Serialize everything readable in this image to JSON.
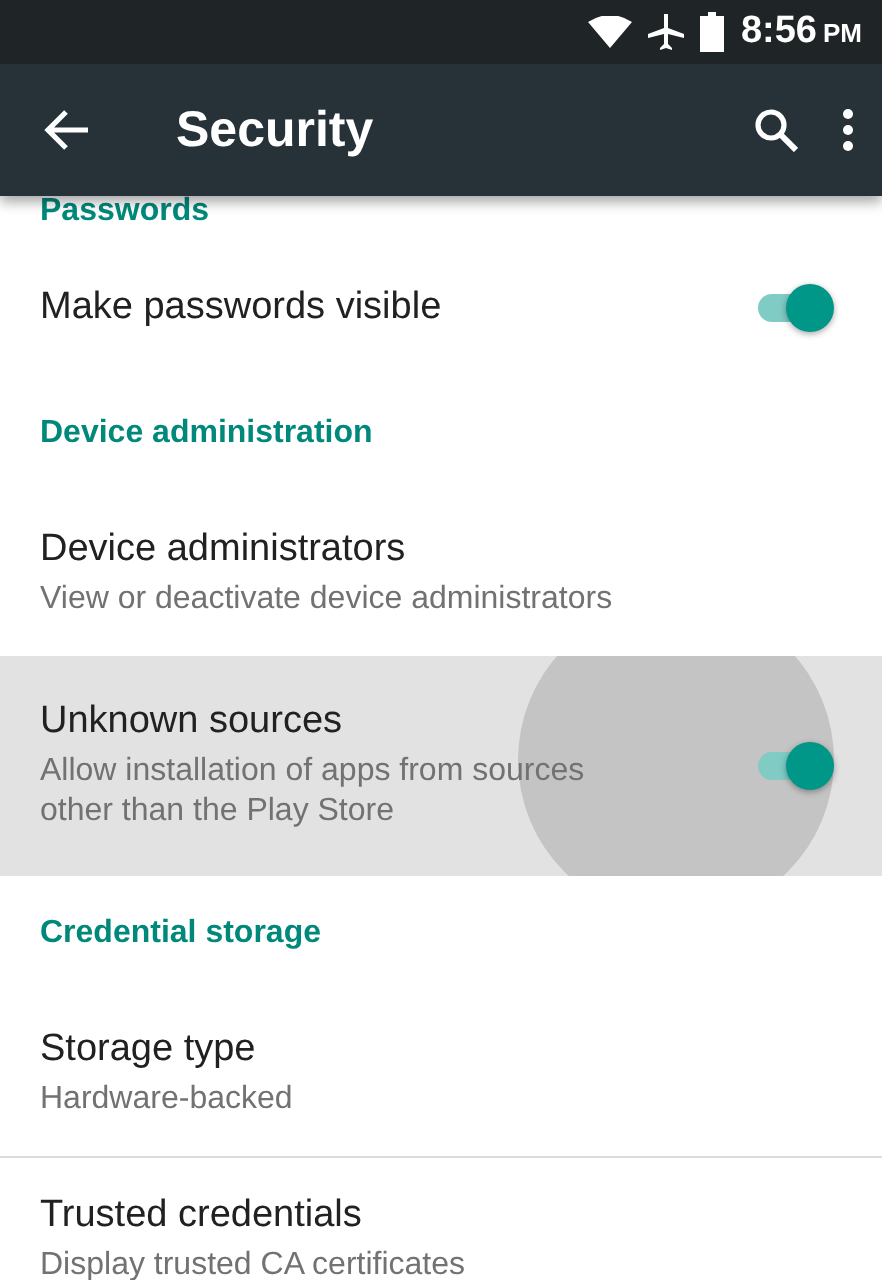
{
  "status_bar": {
    "time": "8:56",
    "meridiem": "PM"
  },
  "app_bar": {
    "title": "Security"
  },
  "items": [
    {
      "kind": "header",
      "title": "Passwords"
    },
    {
      "kind": "switch",
      "title": "Make passwords visible",
      "on": true,
      "pressed": false
    },
    {
      "kind": "header",
      "title": "Device administration"
    },
    {
      "kind": "text",
      "title": "Device administrators",
      "subtitle": "View or deactivate device administrators",
      "pressed": false
    },
    {
      "kind": "switch",
      "title": "Unknown sources",
      "subtitle": "Allow installation of apps from sources other than the Play Store",
      "on": true,
      "pressed": true
    },
    {
      "kind": "header",
      "title": "Credential storage"
    },
    {
      "kind": "text",
      "title": "Storage type",
      "subtitle": "Hardware-backed",
      "pressed": false
    },
    {
      "kind": "divider"
    },
    {
      "kind": "text",
      "title": "Trusted credentials",
      "subtitle": "Display trusted CA certificates",
      "pressed": false
    }
  ]
}
